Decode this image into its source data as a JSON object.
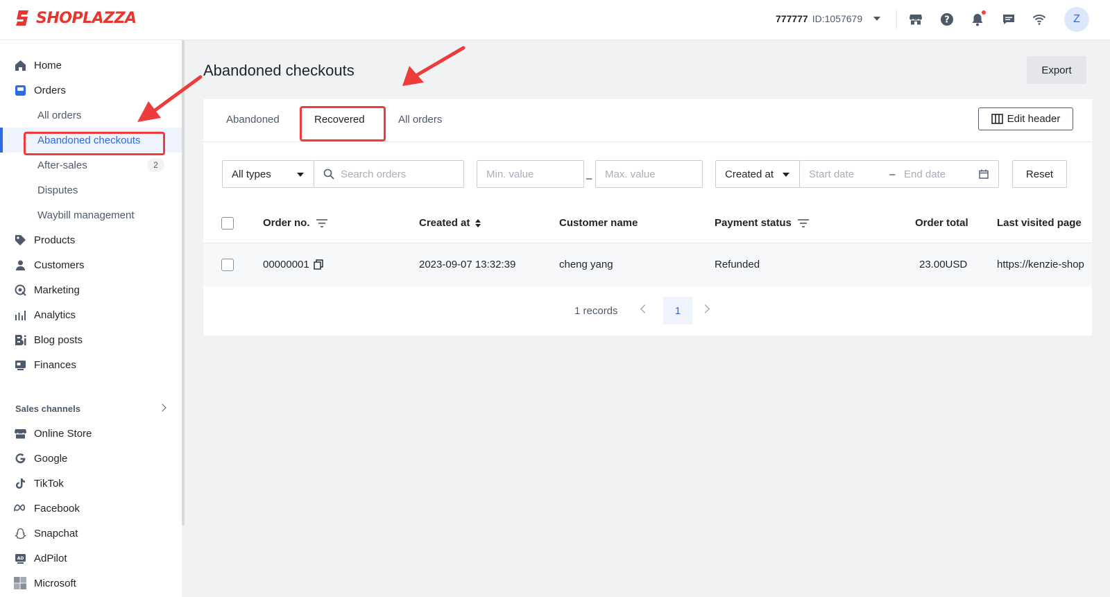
{
  "brand": {
    "name": "SHOPLAZZA"
  },
  "topbar": {
    "store_name": "777777",
    "store_id": "ID:1057679",
    "avatar_initial": "Z"
  },
  "sidebar": {
    "items": [
      {
        "label": "Home",
        "icon": "home-icon"
      },
      {
        "label": "Orders",
        "icon": "orders-icon"
      },
      {
        "label": "All orders"
      },
      {
        "label": "Abandoned checkouts"
      },
      {
        "label": "After-sales",
        "badge": "2"
      },
      {
        "label": "Disputes"
      },
      {
        "label": "Waybill management"
      },
      {
        "label": "Products",
        "icon": "tag-icon"
      },
      {
        "label": "Customers",
        "icon": "person-icon"
      },
      {
        "label": "Marketing",
        "icon": "marketing-icon"
      },
      {
        "label": "Analytics",
        "icon": "bar-chart-icon"
      },
      {
        "label": "Blog posts",
        "icon": "blog-icon"
      },
      {
        "label": "Finances",
        "icon": "finances-icon"
      }
    ],
    "section_label": "Sales channels",
    "channels": [
      {
        "label": "Online Store",
        "icon": "store-icon"
      },
      {
        "label": "Google",
        "icon": "google-icon"
      },
      {
        "label": "TikTok",
        "icon": "tiktok-icon"
      },
      {
        "label": "Facebook",
        "icon": "meta-icon"
      },
      {
        "label": "Snapchat",
        "icon": "snapchat-icon"
      },
      {
        "label": "AdPilot",
        "icon": "adpilot-icon"
      },
      {
        "label": "Microsoft",
        "icon": "microsoft-icon"
      }
    ]
  },
  "main": {
    "title": "Abandoned checkouts",
    "export_label": "Export",
    "tabs": [
      {
        "label": "Abandoned"
      },
      {
        "label": "Recovered"
      },
      {
        "label": "All orders"
      }
    ],
    "active_tab": "Recovered",
    "edit_header_label": "Edit header",
    "filters": {
      "type_value": "All types",
      "search_placeholder": "Search orders",
      "min_placeholder": "Min. value",
      "max_placeholder": "Max. value",
      "date_field_value": "Created at",
      "start_placeholder": "Start date",
      "end_placeholder": "End date",
      "reset_label": "Reset"
    },
    "table": {
      "columns": [
        "Order no.",
        "Created at",
        "Customer name",
        "Payment status",
        "Order total",
        "Last visited page"
      ],
      "rows": [
        [
          "00000001",
          "2023-09-07 13:32:39",
          "cheng yang",
          "Refunded",
          "23.00USD",
          "https://kenzie-shop"
        ]
      ]
    },
    "pagination": {
      "records": "1 records",
      "current_page": "1"
    }
  },
  "colors": {
    "brand": "#e8352e",
    "accent": "#2d6be4",
    "annotation": "#ee3b3b"
  }
}
